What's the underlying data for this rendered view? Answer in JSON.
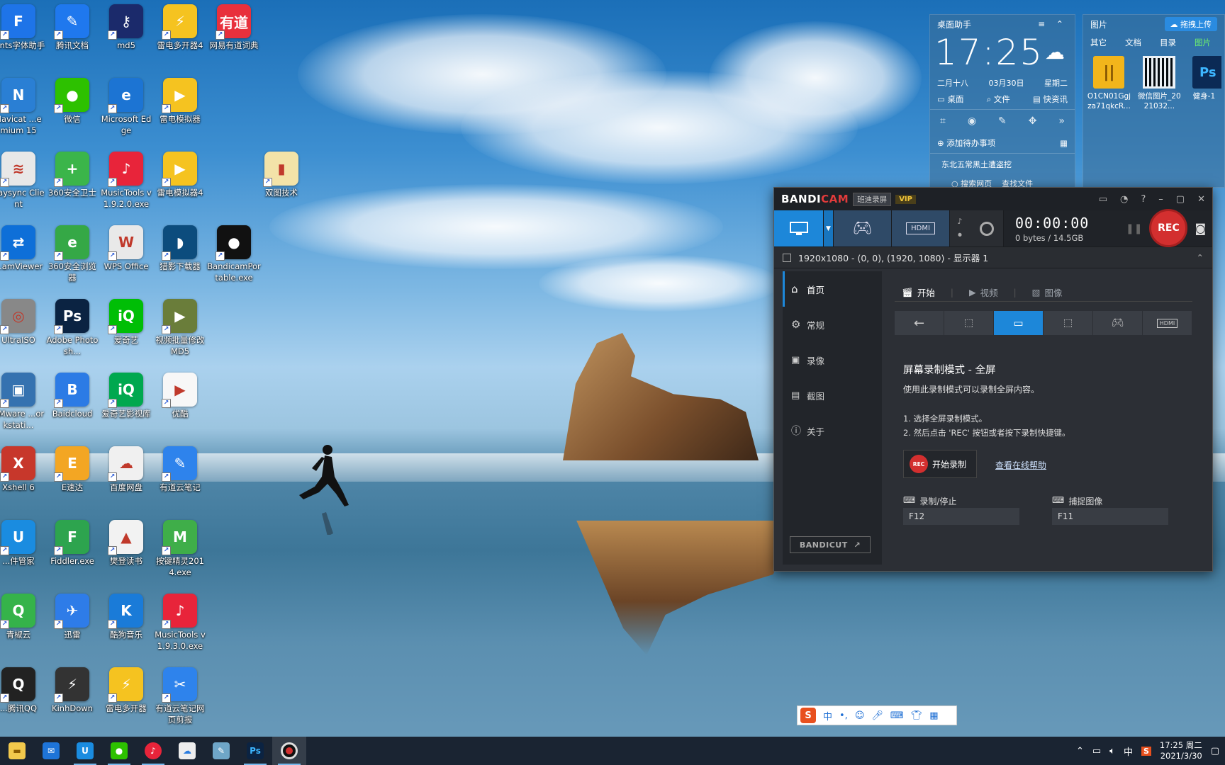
{
  "desktop_icons": [
    {
      "id": "c0r0",
      "label": "...nts字体助手",
      "icon": "font-assistant-icon",
      "color": "#1e74e8",
      "glyph": "F"
    },
    {
      "id": "c0r1",
      "label": "Navicat ...emium 15",
      "icon": "navicat-icon",
      "color": "#2a7fd4",
      "glyph": "N"
    },
    {
      "id": "c0r2",
      "label": "Raysync Client",
      "icon": "raysync-icon",
      "color": "#e8e8e8",
      "glyph": "≋"
    },
    {
      "id": "c0r3",
      "label": "...amViewer",
      "icon": "teamviewer-icon",
      "color": "#0e6fd8",
      "glyph": "⇄"
    },
    {
      "id": "c0r4",
      "label": "UltraISO",
      "icon": "ultraiso-icon",
      "color": "#888",
      "glyph": "◎"
    },
    {
      "id": "c0r5",
      "label": "VMware ...orkstati...",
      "icon": "vmware-icon",
      "color": "#3572b0",
      "glyph": "▣"
    },
    {
      "id": "c0r6",
      "label": "Xshell 6",
      "icon": "xshell-icon",
      "color": "#c7372b",
      "glyph": "X"
    },
    {
      "id": "c0r7",
      "label": "...件管家",
      "icon": "software-manager-icon",
      "color": "#1a8ce0",
      "glyph": "U"
    },
    {
      "id": "c0r8",
      "label": "青椒云",
      "icon": "qingjiao-icon",
      "color": "#35b34a",
      "glyph": "Q"
    },
    {
      "id": "c0r9",
      "label": "...腾讯QQ",
      "icon": "qq-icon",
      "color": "#222",
      "glyph": "Q"
    },
    {
      "id": "c1r0",
      "label": "腾讯文档",
      "icon": "tencent-docs-icon",
      "color": "#1f78ee",
      "glyph": "✎"
    },
    {
      "id": "c1r1",
      "label": "微信",
      "icon": "wechat-icon",
      "color": "#2dc100",
      "glyph": "●"
    },
    {
      "id": "c1r2",
      "label": "360安全卫士",
      "icon": "360-security-icon",
      "color": "#3bb54a",
      "glyph": "+"
    },
    {
      "id": "c1r3",
      "label": "360安全浏览器",
      "icon": "360-browser-icon",
      "color": "#35a846",
      "glyph": "e"
    },
    {
      "id": "c1r4",
      "label": "Adobe Photosh...",
      "icon": "photoshop-icon",
      "color": "#0b2342",
      "glyph": "Ps"
    },
    {
      "id": "c1r5",
      "label": "Baidcloud",
      "icon": "baidcloud-icon",
      "color": "#2c7be5",
      "glyph": "B"
    },
    {
      "id": "c1r6",
      "label": "E速达",
      "icon": "esuda-icon",
      "color": "#f3a623",
      "glyph": "E"
    },
    {
      "id": "c1r7",
      "label": "Fiddler.exe",
      "icon": "fiddler-icon",
      "color": "#2da44e",
      "glyph": "F"
    },
    {
      "id": "c1r8",
      "label": "迅雷",
      "icon": "xunlei-icon",
      "color": "#2e7ce8",
      "glyph": "✈"
    },
    {
      "id": "c1r9",
      "label": "KinhDown",
      "icon": "kinhdown-icon",
      "color": "#333",
      "glyph": "⚡"
    },
    {
      "id": "c2r0",
      "label": "md5",
      "icon": "md5-key-icon",
      "color": "#1b2a6b",
      "glyph": "⚷"
    },
    {
      "id": "c2r1",
      "label": "Microsoft Edge",
      "icon": "edge-icon",
      "color": "#1c74d3",
      "glyph": "e"
    },
    {
      "id": "c2r2",
      "label": "MusicTools v1.9.2.0.exe",
      "icon": "musictools-icon",
      "color": "#e8243a",
      "glyph": "♪"
    },
    {
      "id": "c2r3",
      "label": "WPS Office",
      "icon": "wps-icon",
      "color": "#e9e9e9",
      "glyph": "W"
    },
    {
      "id": "c2r4",
      "label": "爱奇艺",
      "icon": "iqiyi-icon",
      "color": "#00be06",
      "glyph": "iQ"
    },
    {
      "id": "c2r5",
      "label": "爱奇艺影视库",
      "icon": "iqiyi-video-icon",
      "color": "#00a84f",
      "glyph": "iQ"
    },
    {
      "id": "c2r6",
      "label": "百度网盘",
      "icon": "baidu-netdisk-icon",
      "color": "#f0f0f0",
      "glyph": "☁"
    },
    {
      "id": "c2r7",
      "label": "樊登读书",
      "icon": "fandeng-icon",
      "color": "#f2f2f2",
      "glyph": "▲"
    },
    {
      "id": "c2r8",
      "label": "酷狗音乐",
      "icon": "kugou-icon",
      "color": "#1a7bd8",
      "glyph": "K"
    },
    {
      "id": "c2r9",
      "label": "雷电多开器",
      "icon": "ld-multi-icon",
      "color": "#f5c320",
      "glyph": "⚡"
    },
    {
      "id": "c3r0",
      "label": "雷电多开器4",
      "icon": "ld-multi4-icon",
      "color": "#f5c320",
      "glyph": "⚡"
    },
    {
      "id": "c3r1",
      "label": "雷电模拟器",
      "icon": "ld-emulator-icon",
      "color": "#f5c320",
      "glyph": "▶"
    },
    {
      "id": "c3r2",
      "label": "雷电模拟器4",
      "icon": "ld-emulator4-icon",
      "color": "#f5c320",
      "glyph": "▶"
    },
    {
      "id": "c3r3",
      "label": "猎影下载器",
      "icon": "lieying-icon",
      "color": "#0c4c7d",
      "glyph": "◗"
    },
    {
      "id": "c3r4",
      "label": "视频批量修改MD5",
      "icon": "video-md5-icon",
      "color": "#6a7d3a",
      "glyph": "▶"
    },
    {
      "id": "c3r5",
      "label": "优酷",
      "icon": "youku-icon",
      "color": "#f7f7f7",
      "glyph": "▶"
    },
    {
      "id": "c3r6",
      "label": "有道云笔记",
      "icon": "youdao-note-icon",
      "color": "#2e83ec",
      "glyph": "✎"
    },
    {
      "id": "c3r7",
      "label": "按键精灵2014.exe",
      "icon": "keyboard-sprite-icon",
      "color": "#3fae49",
      "glyph": "M"
    },
    {
      "id": "c3r8",
      "label": "MusicTools v1.9.3.0.exe",
      "icon": "musictools2-icon",
      "color": "#e8243a",
      "glyph": "♪"
    },
    {
      "id": "c3r9",
      "label": "有道云笔记网页剪报",
      "icon": "youdao-clip-icon",
      "color": "#2e83ec",
      "glyph": "✂"
    },
    {
      "id": "c4r0",
      "label": "网易有道词典",
      "icon": "youdao-dict-icon",
      "color": "#e8303c",
      "glyph": "有道"
    },
    {
      "id": "c4r3",
      "label": "BandicamPortable.exe",
      "icon": "bandicam-portable-icon",
      "color": "#111",
      "glyph": "●"
    },
    {
      "id": "c5r2",
      "label": "双图技术",
      "icon": "folder-doc-icon",
      "color": "#f3e3a8",
      "glyph": "▮"
    }
  ],
  "assistant_widget": {
    "title": "桌面助手",
    "time": "17:25",
    "lunar": "二月十八",
    "date": "03月30日",
    "weekday": "星期二",
    "links": [
      "桌面",
      "文件",
      "快资讯"
    ],
    "todo": "添加待办事项",
    "news": "东北五常黑土遭盗挖",
    "search": "搜索网页",
    "find": "查找文件"
  },
  "pictures_widget": {
    "title": "图片",
    "upload": "拖拽上传",
    "tabs": [
      "其它",
      "文档",
      "目录",
      "图片"
    ],
    "files": [
      {
        "name": "O1CN01Ggjza71qkcR...",
        "icon": "archive-icon"
      },
      {
        "name": "微信图片_2021032...",
        "icon": "qrcode-icon"
      },
      {
        "name": "健身-1",
        "icon": "psd-icon"
      }
    ]
  },
  "bandicam": {
    "brand_a": "BANDI",
    "brand_b": "CAM",
    "brand_tag": "班迪录屏",
    "vip": "VIP",
    "timer": "00:00:00",
    "size": "0 bytes / 14.5GB",
    "rec": "REC",
    "selection": "1920x1080 - (0, 0), (1920, 1080) - 显示器 1",
    "sidebar": [
      "首页",
      "常规",
      "录像",
      "截图",
      "关于"
    ],
    "subtabs": [
      "开始",
      "视频",
      "图像"
    ],
    "mode_title": "屏幕录制模式 - 全屏",
    "mode_desc": "使用此录制模式可以录制全屏内容。",
    "step1": "1. 选择全屏录制模式。",
    "step2": "2. 然后点击 'REC' 按钮或者按下录制快捷键。",
    "start_btn": "开始录制",
    "start_rec_badge": "REC",
    "help_link": "查看在线帮助",
    "hotkey_rec_label": "录制/停止",
    "hotkey_rec": "F12",
    "hotkey_cap_label": "捕捉图像",
    "hotkey_cap": "F11",
    "bandicut": "BANDICUT"
  },
  "ime_bar": {
    "mode": "中",
    "punct": "•,"
  },
  "taskbar": {
    "apps": [
      "file-explorer-icon",
      "mail-icon",
      "software-manager-icon",
      "wechat-icon",
      "musictools-icon",
      "baidu-netdisk-icon",
      "notes-icon",
      "photoshop-icon",
      "bandicam-icon"
    ],
    "tray_ime": "中",
    "time": "17:25 周二",
    "date": "2021/3/30"
  },
  "colors": {
    "accent": "#1d87d9",
    "rec_red": "#d32f2f",
    "dark_bg": "#2c2f35"
  }
}
